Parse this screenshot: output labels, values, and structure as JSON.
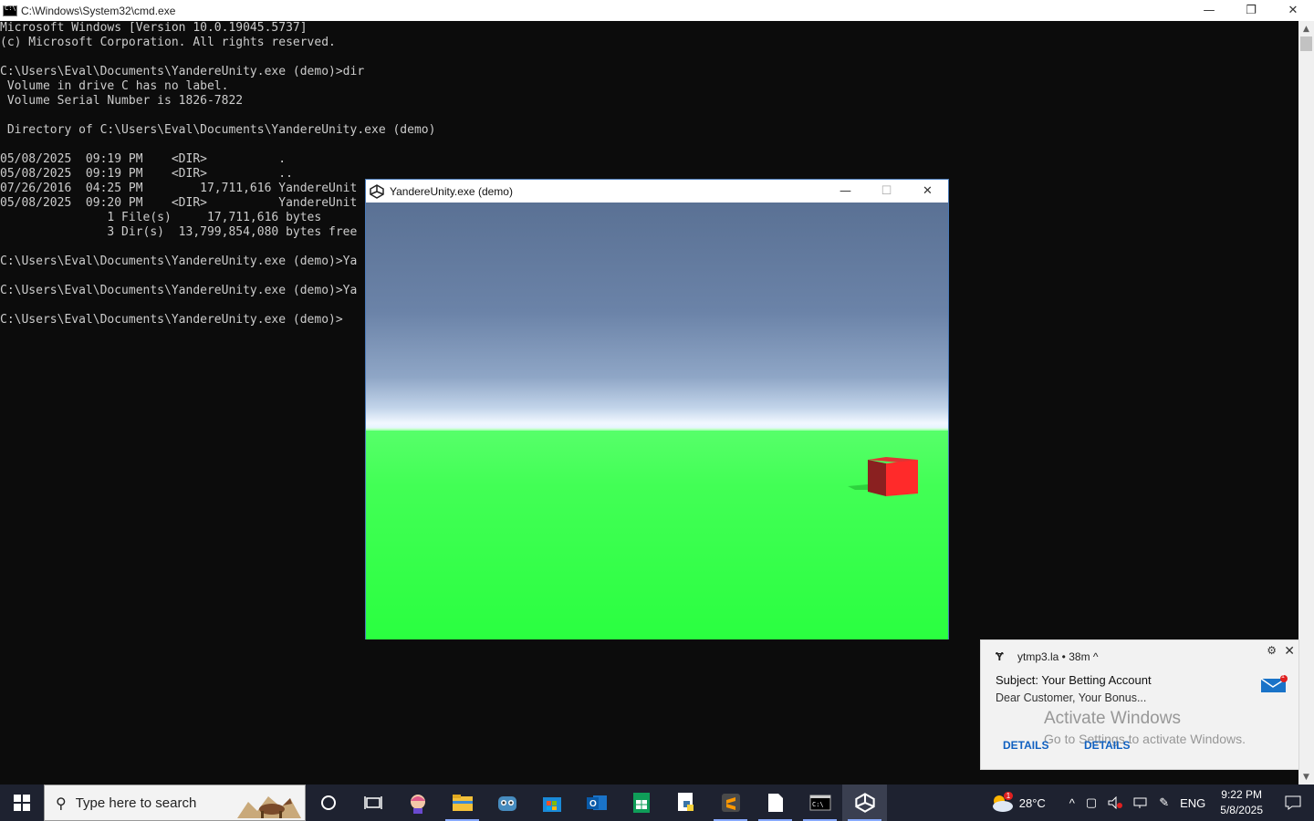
{
  "cmd": {
    "title": "C:\\Windows\\System32\\cmd.exe",
    "lines": [
      "Microsoft Windows [Version 10.0.19045.5737]",
      "(c) Microsoft Corporation. All rights reserved.",
      "",
      "C:\\Users\\Eval\\Documents\\YandereUnity.exe (demo)>dir",
      " Volume in drive C has no label.",
      " Volume Serial Number is 1826-7822",
      "",
      " Directory of C:\\Users\\Eval\\Documents\\YandereUnity.exe (demo)",
      "",
      "05/08/2025  09:19 PM    <DIR>          .",
      "05/08/2025  09:19 PM    <DIR>          ..",
      "07/26/2016  04:25 PM        17,711,616 YandereUnit",
      "05/08/2025  09:20 PM    <DIR>          YandereUnit",
      "               1 File(s)     17,711,616 bytes",
      "               3 Dir(s)  13,799,854,080 bytes free",
      "",
      "C:\\Users\\Eval\\Documents\\YandereUnity.exe (demo)>Ya",
      "",
      "C:\\Users\\Eval\\Documents\\YandereUnity.exe (demo)>Ya",
      "",
      "C:\\Users\\Eval\\Documents\\YandereUnity.exe (demo)>"
    ],
    "controls": {
      "minimize": "—",
      "restore": "❐",
      "close": "✕"
    }
  },
  "unity": {
    "title": "YandereUnity.exe (demo)",
    "controls": {
      "minimize": "—",
      "maximize": "☐",
      "close": "✕"
    },
    "colors": {
      "sky_top": "#5a7194",
      "horizon": "#f2f8ff",
      "ground": "#2aff40",
      "cube": "#ff2a2a"
    }
  },
  "toast": {
    "app": "ytmp3.la  •  38m ^",
    "subject": "Subject: Your Betting Account",
    "body": "Dear Customer, Your Bonus...",
    "badge": "1",
    "watermark_title": "Activate Windows",
    "watermark_sub": "Go to Settings to activate Windows.",
    "button1": "DETAILS",
    "button2": "DETAILS"
  },
  "taskbar": {
    "search_placeholder": "Type here to search",
    "weather_temp": "28°C",
    "weather_badge": "1",
    "language": "ENG",
    "time": "9:22 PM",
    "date": "5/8/2025"
  }
}
